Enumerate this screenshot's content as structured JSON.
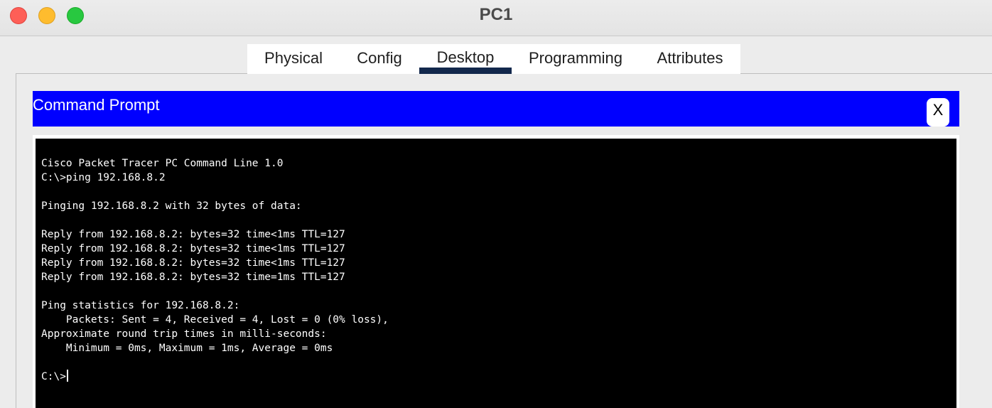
{
  "window": {
    "title": "PC1",
    "controls": [
      "close",
      "minimize",
      "zoom"
    ]
  },
  "tabs": [
    {
      "label": "Physical",
      "active": false
    },
    {
      "label": "Config",
      "active": false
    },
    {
      "label": "Desktop",
      "active": true
    },
    {
      "label": "Programming",
      "active": false
    },
    {
      "label": "Attributes",
      "active": false
    }
  ],
  "app": {
    "title": "Command Prompt",
    "close_label": "X",
    "header_color": "#0000ff"
  },
  "terminal": {
    "prompt": "C:\\>",
    "lines": [
      "Cisco Packet Tracer PC Command Line 1.0",
      "C:\\>ping 192.168.8.2",
      "",
      "Pinging 192.168.8.2 with 32 bytes of data:",
      "",
      "Reply from 192.168.8.2: bytes=32 time<1ms TTL=127",
      "Reply from 192.168.8.2: bytes=32 time<1ms TTL=127",
      "Reply from 192.168.8.2: bytes=32 time<1ms TTL=127",
      "Reply from 192.168.8.2: bytes=32 time=1ms TTL=127",
      "",
      "Ping statistics for 192.168.8.2:",
      "    Packets: Sent = 4, Received = 4, Lost = 0 (0% loss),",
      "Approximate round trip times in milli-seconds:",
      "    Minimum = 0ms, Maximum = 1ms, Average = 0ms",
      ""
    ]
  }
}
